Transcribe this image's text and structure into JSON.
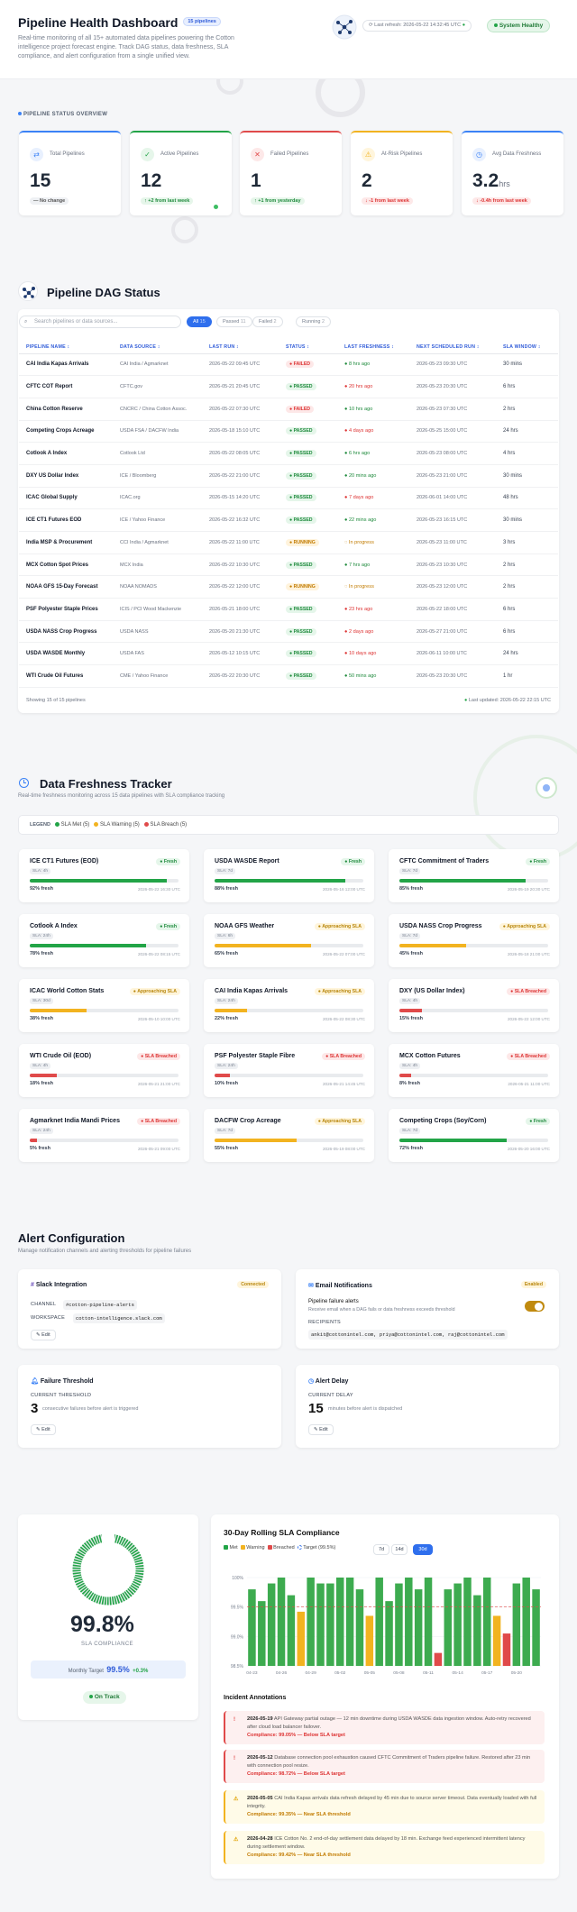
{
  "header": {
    "title": "Pipeline Health Dashboard",
    "badge": "15 pipelines",
    "subtitle": "Real-time monitoring of all 15+ automated data pipelines powering the Cotton intelligence project forecast engine. Track DAG status, data freshness, SLA compliance, and alert configuration from a single unified view.",
    "last_refresh": "Last refresh: 2026-05-22 14:32:45 UTC",
    "health": "System Healthy"
  },
  "status_overview": {
    "label": "PIPELINE STATUS OVERVIEW",
    "kpis": [
      {
        "icon": "shuffle-icon",
        "label": "Total Pipelines",
        "value": "15",
        "unit": "",
        "change": "— No change",
        "tone": "neutral",
        "color": "#3b82f6"
      },
      {
        "icon": "check-circle-icon",
        "label": "Active Pipelines",
        "value": "12",
        "unit": "",
        "change": "↑ +2 from last week",
        "tone": "up",
        "color": "#22a447"
      },
      {
        "icon": "x-circle-icon",
        "label": "Failed Pipelines",
        "value": "1",
        "unit": "",
        "change": "↑ +1 from yesterday",
        "tone": "up",
        "color": "#e04a4a"
      },
      {
        "icon": "warning-icon",
        "label": "At-Risk Pipelines",
        "value": "2",
        "unit": "",
        "change": "↓ -1 from last week",
        "tone": "down",
        "color": "#f2b320"
      },
      {
        "icon": "clock-icon",
        "label": "Avg Data Freshness",
        "value": "3.2",
        "unit": "hrs",
        "change": "↓ -0.4h from last week",
        "tone": "down",
        "color": "#3b82f6"
      }
    ]
  },
  "dag": {
    "title": "Pipeline DAG Status",
    "search_placeholder": "Search pipelines or data sources...",
    "filters": [
      {
        "label": "All",
        "count": "15"
      },
      {
        "label": "Passed",
        "count": "11"
      },
      {
        "label": "Failed",
        "count": "2"
      },
      {
        "label": "Running",
        "count": "2"
      }
    ],
    "columns": [
      "PIPELINE NAME ↕",
      "DATA SOURCE ↕",
      "LAST RUN ↕",
      "STATUS ↕",
      "LAST FRESHNESS ↕",
      "NEXT SCHEDULED RUN ↕",
      "SLA WINDOW ↕"
    ],
    "rows": [
      [
        "CAI India Kapas Arrivals",
        "CAI India / Agmarknet",
        "2026-05-22 09:45 UTC",
        "FAILED",
        "8 hrs ago",
        "g",
        "2026-05-23 09:30 UTC",
        "30 mins"
      ],
      [
        "CFTC COT Report",
        "CFTC.gov",
        "2026-05-21 20:45 UTC",
        "PASSED",
        "20 hrs ago",
        "r",
        "2026-05-23 20:30 UTC",
        "6 hrs"
      ],
      [
        "China Cotton Reserve",
        "CNCRC / China Cotton Assoc.",
        "2026-05-22 07:30 UTC",
        "FAILED",
        "10 hrs ago",
        "g",
        "2026-05-23 07:30 UTC",
        "2 hrs"
      ],
      [
        "Competing Crops Acreage",
        "USDA FSA / DACFW India",
        "2026-05-18 15:10 UTC",
        "PASSED",
        "4 days ago",
        "r",
        "2026-05-25 15:00 UTC",
        "24 hrs"
      ],
      [
        "Cotlook A Index",
        "Cotlook Ltd",
        "2026-05-22 08:05 UTC",
        "PASSED",
        "6 hrs ago",
        "g",
        "2026-05-23 08:00 UTC",
        "4 hrs"
      ],
      [
        "DXY US Dollar Index",
        "ICE / Bloomberg",
        "2026-05-22 21:00 UTC",
        "PASSED",
        "20 mins ago",
        "g",
        "2026-05-23 21:00 UTC",
        "30 mins"
      ],
      [
        "ICAC Global Supply",
        "ICAC.org",
        "2026-05-15 14:20 UTC",
        "PASSED",
        "7 days ago",
        "r",
        "2026-06-01 14:00 UTC",
        "48 hrs"
      ],
      [
        "ICE CT1 Futures EOD",
        "ICE / Yahoo Finance",
        "2026-05-22 16:32 UTC",
        "PASSED",
        "22 mins ago",
        "g",
        "2026-05-23 16:15 UTC",
        "30 mins"
      ],
      [
        "India MSP & Procurement",
        "CCI India / Agmarknet",
        "2026-05-22 11:00 UTC",
        "RUNNING",
        "In progress",
        "o",
        "2026-05-23 11:00 UTC",
        "3 hrs"
      ],
      [
        "MCX Cotton Spot Prices",
        "MCX India",
        "2026-05-22 10:30 UTC",
        "PASSED",
        "7 hrs ago",
        "g",
        "2026-05-23 10:30 UTC",
        "2 hrs"
      ],
      [
        "NOAA GFS 15-Day Forecast",
        "NOAA NOMADS",
        "2026-05-22 12:00 UTC",
        "RUNNING",
        "In progress",
        "o",
        "2026-05-23 12:00 UTC",
        "2 hrs"
      ],
      [
        "PSF Polyester Staple Prices",
        "ICIS / PCI Wood Mackenzie",
        "2026-05-21 18:00 UTC",
        "PASSED",
        "23 hrs ago",
        "r",
        "2026-05-22 18:00 UTC",
        "6 hrs"
      ],
      [
        "USDA NASS Crop Progress",
        "USDA NASS",
        "2026-05-20 21:30 UTC",
        "PASSED",
        "2 days ago",
        "r",
        "2026-05-27 21:00 UTC",
        "6 hrs"
      ],
      [
        "USDA WASDE Monthly",
        "USDA FAS",
        "2026-05-12 10:15 UTC",
        "PASSED",
        "10 days ago",
        "r",
        "2026-06-11 10:00 UTC",
        "24 hrs"
      ],
      [
        "WTI Crude Oil Futures",
        "CME / Yahoo Finance",
        "2026-05-22 20:30 UTC",
        "PASSED",
        "50 mins ago",
        "g",
        "2026-05-23 20:30 UTC",
        "1 hr"
      ]
    ],
    "showing": "Showing 15 of 15 pipelines",
    "updated": "Last updated: 2026-05-22 22:15 UTC"
  },
  "freshness": {
    "title": "Data Freshness Tracker",
    "subtitle": "Real-time freshness monitoring across 15 data pipelines with SLA compliance tracking",
    "legend": {
      "label": "LEGEND",
      "met": "SLA Met (5)",
      "warn": "SLA Warning (5)",
      "breach": "SLA Breach (5)"
    },
    "cards": [
      {
        "name": "ICE CT1 Futures (EOD)",
        "sla": "SLA: 4h",
        "status": "Fresh",
        "pct": 92,
        "pct_label": "92% fresh",
        "ts": "2026-05-22 16:30 UTC"
      },
      {
        "name": "USDA WASDE Report",
        "sla": "SLA: 7d",
        "status": "Fresh",
        "pct": 88,
        "pct_label": "88% fresh",
        "ts": "2026-05-16 12:00 UTC"
      },
      {
        "name": "CFTC Commitment of Traders",
        "sla": "SLA: 7d",
        "status": "Fresh",
        "pct": 85,
        "pct_label": "85% fresh",
        "ts": "2026-05-19 20:30 UTC"
      },
      {
        "name": "Cotlook A Index",
        "sla": "SLA: 24h",
        "status": "Fresh",
        "pct": 78,
        "pct_label": "78% fresh",
        "ts": "2026-05-22 08:15 UTC"
      },
      {
        "name": "NOAA GFS Weather",
        "sla": "SLA: 6h",
        "status": "Approaching SLA",
        "pct": 65,
        "pct_label": "65% fresh",
        "ts": "2026-05-22 07:00 UTC"
      },
      {
        "name": "USDA NASS Crop Progress",
        "sla": "SLA: 7d",
        "status": "Approaching SLA",
        "pct": 45,
        "pct_label": "45% fresh",
        "ts": "2026-05-18 21:00 UTC"
      },
      {
        "name": "ICAC World Cotton Stats",
        "sla": "SLA: 30d",
        "status": "Approaching SLA",
        "pct": 38,
        "pct_label": "38% fresh",
        "ts": "2026-05-10 10:00 UTC"
      },
      {
        "name": "CAI India Kapas Arrivals",
        "sla": "SLA: 24h",
        "status": "Approaching SLA",
        "pct": 22,
        "pct_label": "22% fresh",
        "ts": "2026-05-22 08:30 UTC"
      },
      {
        "name": "DXY (US Dollar Index)",
        "sla": "SLA: 4h",
        "status": "SLA Breached",
        "pct": 15,
        "pct_label": "15% fresh",
        "ts": "2026-05-22 12:00 UTC"
      },
      {
        "name": "WTI Crude Oil (EOD)",
        "sla": "SLA: 4h",
        "status": "SLA Breached",
        "pct": 18,
        "pct_label": "18% fresh",
        "ts": "2026-05-21 21:00 UTC"
      },
      {
        "name": "PSF Polyester Staple Fibre",
        "sla": "SLA: 24h",
        "status": "SLA Breached",
        "pct": 10,
        "pct_label": "10% fresh",
        "ts": "2026-05-21 14:45 UTC"
      },
      {
        "name": "MCX Cotton Futures",
        "sla": "SLA: 4h",
        "status": "SLA Breached",
        "pct": 8,
        "pct_label": "8% fresh",
        "ts": "2026-05-21 11:00 UTC"
      },
      {
        "name": "Agmarknet India Mandi Prices",
        "sla": "SLA: 24h",
        "status": "SLA Breached",
        "pct": 5,
        "pct_label": "5% fresh",
        "ts": "2026-05-21 09:00 UTC"
      },
      {
        "name": "DACFW Crop Acreage",
        "sla": "SLA: 7d",
        "status": "Approaching SLA",
        "pct": 55,
        "pct_label": "55% fresh",
        "ts": "2026-05-19 08:00 UTC"
      },
      {
        "name": "Competing Crops (Soy/Corn)",
        "sla": "SLA: 7d",
        "status": "Fresh",
        "pct": 72,
        "pct_label": "72% fresh",
        "ts": "2026-05-20 16:00 UTC"
      }
    ]
  },
  "alerts": {
    "title": "Alert Configuration",
    "subtitle": "Manage notification channels and alerting thresholds for pipeline failures",
    "slack": {
      "title": "Slack Integration",
      "tag": "Connected",
      "channel_label": "CHANNEL",
      "channel": "#cotton-pipeline-alerts",
      "ws_label": "WORKSPACE",
      "workspace": "cotton-intelligence.slack.com",
      "edit": "Edit"
    },
    "email": {
      "title": "Email Notifications",
      "tag": "Enabled",
      "toggle_title": "Pipeline failure alerts",
      "toggle_desc": "Receive email when a DAG fails or data freshness exceeds threshold",
      "rec_label": "RECIPIENTS",
      "recipients": "ankit@cottonintel.com, priya@cottonintel.com, raj@cottonintel.com"
    },
    "threshold": {
      "title": "Failure Threshold",
      "label": "CURRENT THRESHOLD",
      "value": "3",
      "desc": "consecutive failures before alert is triggered",
      "edit": "Edit"
    },
    "delay": {
      "title": "Alert Delay",
      "label": "CURRENT DELAY",
      "value": "15",
      "desc": "minutes before alert is dispatched",
      "edit": "Edit"
    }
  },
  "sla": {
    "value": "99.8%",
    "label": "SLA COMPLIANCE",
    "target_label": "Monthly Target",
    "target": "99.5%",
    "delta": "+0.3%",
    "status": "On Track",
    "chart_title": "30-Day Rolling SLA Compliance",
    "tabs": [
      "7d",
      "14d",
      "30d"
    ],
    "legend": {
      "met": "Met",
      "warn": "Warning",
      "breach": "Breached",
      "target": "Target (99.5%)"
    }
  },
  "incidents": {
    "title": "Incident Annotations",
    "items": [
      {
        "date": "2026-05-19",
        "text": "API Gateway partial outage — 12 min downtime during USDA WASDE data ingestion window. Auto-retry recovered after cloud load balancer failover.",
        "comp": "Compliance: 99.05% — Below SLA target",
        "kind": "r"
      },
      {
        "date": "2026-05-12",
        "text": "Database connection pool exhaustion caused CFTC Commitment of Traders pipeline failure. Restored after 23 min with connection pool resize.",
        "comp": "Compliance: 98.72% — Below SLA target",
        "kind": "r"
      },
      {
        "date": "2026-05-05",
        "text": "CAI India Kapas arrivals data refresh delayed by 45 min due to source server timeout. Data eventually loaded with full integrity.",
        "comp": "Compliance: 99.35% — Near SLA threshold",
        "kind": "o"
      },
      {
        "date": "2026-04-28",
        "text": "ICE Cotton No. 2 end-of-day settlement data delayed by 18 min. Exchange feed experienced intermittent latency during settlement window.",
        "comp": "Compliance: 99.42% — Near SLA threshold",
        "kind": "o"
      }
    ]
  },
  "chart_data": {
    "type": "bar",
    "title": "30-Day Rolling SLA Compliance",
    "xlabel": "",
    "ylabel": "",
    "categories": [
      "04-23",
      "04-24",
      "04-25",
      "04-26",
      "04-27",
      "04-28",
      "04-29",
      "04-30",
      "05-01",
      "05-02",
      "05-03",
      "05-04",
      "05-05",
      "05-06",
      "05-07",
      "05-08",
      "05-09",
      "05-10",
      "05-11",
      "05-12",
      "05-13",
      "05-14",
      "05-15",
      "05-16",
      "05-17",
      "05-18",
      "05-19",
      "05-20",
      "05-21",
      "05-22"
    ],
    "tick_labels": [
      "04-23",
      "04-26",
      "04-29",
      "05-02",
      "05-05",
      "05-08",
      "05-11",
      "05-14",
      "05-17",
      "05-20"
    ],
    "y_ticks": [
      "100%",
      "99.5%",
      "99.0%",
      "98.5%"
    ],
    "ylim": [
      98.5,
      100
    ],
    "target": 99.5,
    "series": [
      {
        "name": "Compliance",
        "values": [
          99.8,
          99.6,
          99.9,
          100,
          99.7,
          99.42,
          100,
          99.9,
          99.9,
          100,
          100,
          99.8,
          99.35,
          100,
          99.6,
          99.9,
          100,
          99.8,
          100,
          98.72,
          99.8,
          99.9,
          100,
          99.7,
          100,
          99.35,
          99.05,
          99.9,
          100,
          99.8
        ],
        "status": [
          "m",
          "m",
          "m",
          "m",
          "m",
          "w",
          "m",
          "m",
          "m",
          "m",
          "m",
          "m",
          "w",
          "m",
          "m",
          "m",
          "m",
          "m",
          "m",
          "b",
          "m",
          "m",
          "m",
          "m",
          "m",
          "w",
          "b",
          "m",
          "m",
          "m"
        ]
      }
    ]
  }
}
